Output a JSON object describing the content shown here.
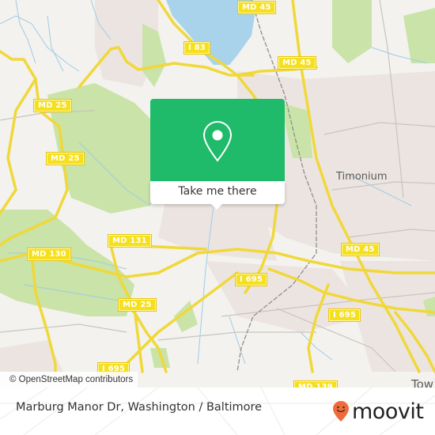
{
  "map": {
    "road_shields": [
      {
        "id": "md45-top",
        "label": "MD 45"
      },
      {
        "id": "i83",
        "label": "I 83"
      },
      {
        "id": "md45-mid",
        "label": "MD 45"
      },
      {
        "id": "md25-top",
        "label": "MD 25"
      },
      {
        "id": "md25-mid",
        "label": "MD 25"
      },
      {
        "id": "md131",
        "label": "MD 131"
      },
      {
        "id": "md130",
        "label": "MD 130"
      },
      {
        "id": "md45-right",
        "label": "MD 45"
      },
      {
        "id": "i695-center",
        "label": "I 695"
      },
      {
        "id": "md25-bottom",
        "label": "MD 25"
      },
      {
        "id": "i695-right",
        "label": "I 695"
      },
      {
        "id": "i695-bottom",
        "label": "I 695"
      },
      {
        "id": "md139",
        "label": "MD 139"
      }
    ],
    "place_labels": {
      "timonium": "Timonium",
      "towson": "Tow"
    },
    "colors": {
      "background": "#f3f2ee",
      "water": "#a9d3ea",
      "park": "#c9e3a8",
      "urban": "#ece4e1",
      "road": "#f6df1c",
      "accent_green": "#1fbb6b",
      "moovit_orange": "#f06b3b"
    },
    "attribution": "© OpenStreetMap contributors"
  },
  "popup": {
    "icon": "location-pin-icon",
    "button_label": "Take me there"
  },
  "footer": {
    "title": "Marburg Manor Dr, Washington / Baltimore",
    "logo_text": "moovit",
    "logo_icon": "moovit-smile-pin-icon"
  }
}
